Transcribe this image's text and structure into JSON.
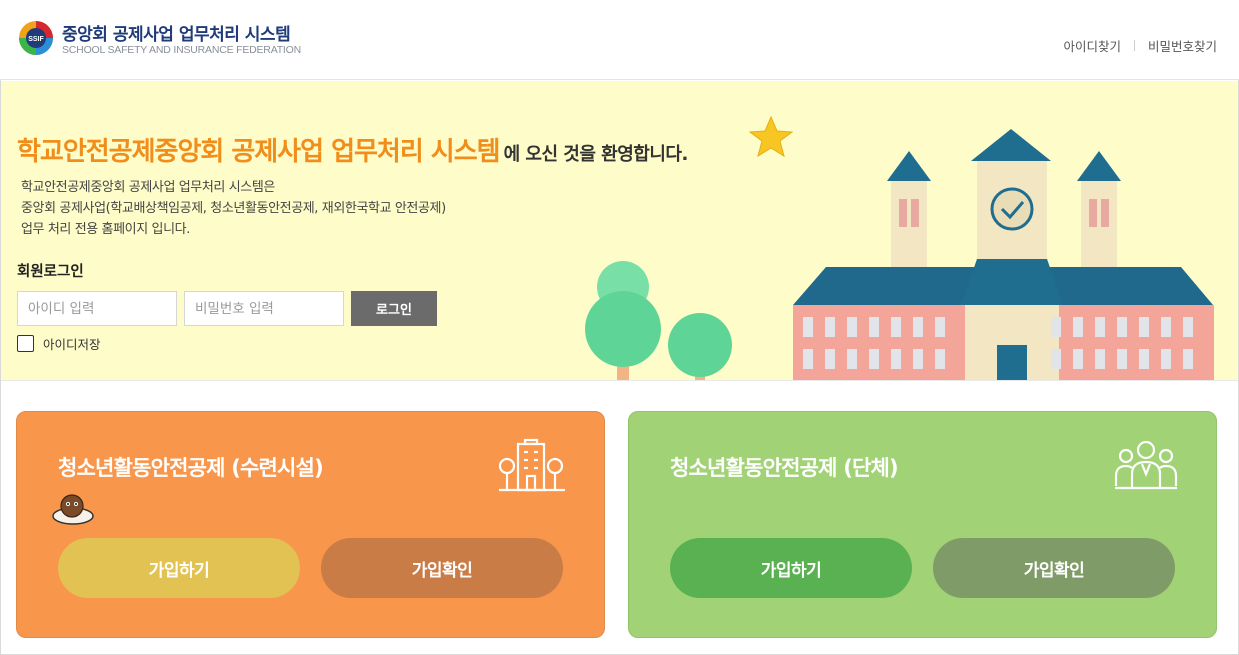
{
  "header": {
    "title": "중앙회 공제사업 업무처리 시스템",
    "subtitle": "SCHOOL SAFETY AND INSURANCE FEDERATION",
    "logo_text": "SSIF",
    "links": {
      "find_id": "아이디찾기",
      "find_pw": "비밀번호찾기"
    }
  },
  "hero": {
    "title_highlight": "학교안전공제중앙회 공제사업 업무처리 시스템",
    "title_rest": "에 오신 것을 환영합니다.",
    "desc": [
      "학교안전공제중앙회 공제사업 업무처리 시스템은",
      "중앙회 공제사업(학교배상책임공제, 청소년활동안전공제, 재외한국학교 안전공제)",
      "업무 처리 전용 홈페이지 입니다."
    ]
  },
  "login": {
    "label": "회원로그인",
    "id_placeholder": "아이디 입력",
    "pw_placeholder": "비밀번호 입력",
    "button": "로그인",
    "save_id": "아이디저장"
  },
  "cards": [
    {
      "title": "청소년활동안전공제 (수련시설)",
      "icon": "building-icon",
      "join": "가입하기",
      "confirm": "가입확인"
    },
    {
      "title": "청소년활동안전공제 (단체)",
      "icon": "group-icon",
      "join": "가입하기",
      "confirm": "가입확인"
    }
  ],
  "colors": {
    "brand": "#1f3b7a",
    "accent": "#f08d1b",
    "hero_bg": "#fefcc8",
    "card_orange": "#f8964c",
    "card_green": "#a1d276"
  }
}
